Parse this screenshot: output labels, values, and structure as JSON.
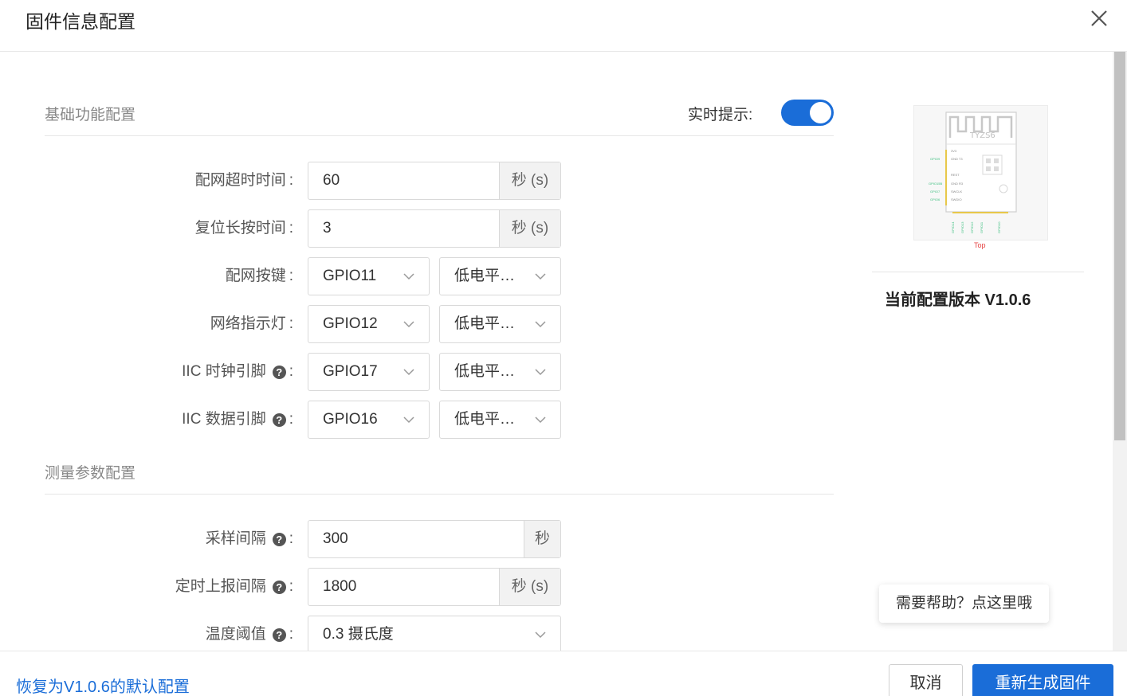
{
  "dialog": {
    "title": "固件信息配置"
  },
  "basic": {
    "section_title": "基础功能配置",
    "realtime_label": "实时提示:",
    "realtime_enabled": true,
    "rows": [
      {
        "label": "配网超时时间",
        "value": "60",
        "unit": "秒 (s)"
      },
      {
        "label": "复位长按时间",
        "value": "3",
        "unit": "秒 (s)"
      },
      {
        "label": "配网按键",
        "pin": "GPIO11",
        "level": "低电平…"
      },
      {
        "label": "网络指示灯",
        "pin": "GPIO12",
        "level": "低电平…"
      },
      {
        "label": "IIC 时钟引脚",
        "pin": "GPIO17",
        "level": "低电平…"
      },
      {
        "label": "IIC 数据引脚",
        "pin": "GPIO16",
        "level": "低电平…"
      }
    ]
  },
  "measure": {
    "section_title": "测量参数配置",
    "rows": [
      {
        "label": "采样间隔",
        "value": "300",
        "unit": "秒"
      },
      {
        "label": "定时上报间隔",
        "value": "1800",
        "unit": "秒 (s)"
      },
      {
        "label": "温度阈值",
        "value": "0.3 摄氏度"
      }
    ]
  },
  "module": {
    "chip_name": "TYZS6",
    "top_label": "Top",
    "left_pins": [
      "GPIO9",
      "GPIO15B",
      "GPIO7",
      "GPIO6"
    ],
    "bottom_pins": [
      "GPIO14",
      "GPIO13",
      "GPIO12",
      "GPIO11",
      "GPIO10"
    ],
    "version_text": "当前配置版本 V1.0.6"
  },
  "help_bubble": "需要帮助？点这里哦",
  "footer": {
    "restore_link": "恢复为V1.0.6的默认配置",
    "cancel": "取消",
    "regenerate": "重新生成固件"
  },
  "colors": {
    "primary": "#1a6dd8",
    "addon_bg": "#f2f2f2",
    "border": "#d9d9d9"
  }
}
